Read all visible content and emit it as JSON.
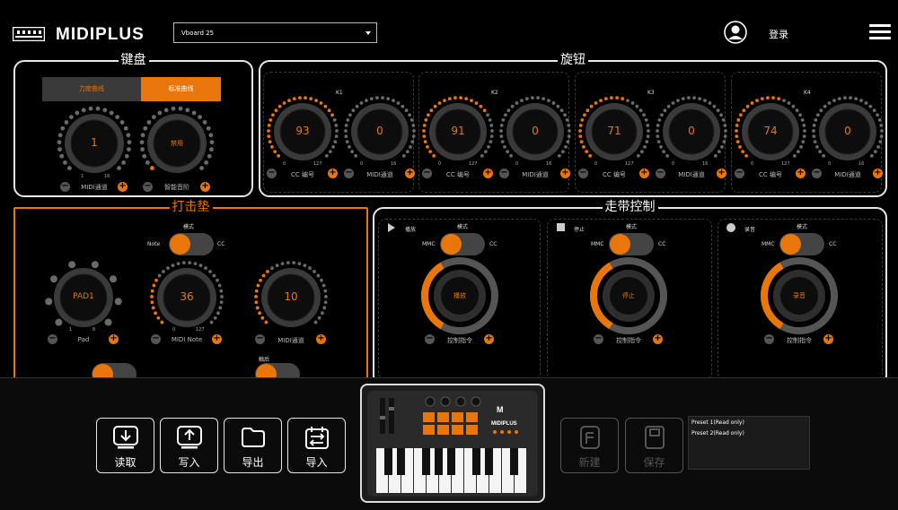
{
  "header": {
    "logo_text": "MIDIPLUS",
    "device_selected": "Vboard 25",
    "login_label": "登录"
  },
  "keyboard": {
    "title": "键盘",
    "tabs": [
      "力度曲线",
      "标准曲线"
    ],
    "active_tab": 1,
    "knobs": [
      {
        "value": "1",
        "label": "MIDI通道",
        "min": "1",
        "max": "16"
      },
      {
        "value": "禁用",
        "label": "智能音阶",
        "min": "",
        "max": ""
      }
    ]
  },
  "rotary": {
    "title": "旋钮",
    "groups": [
      {
        "name": "K1",
        "cc": {
          "value": "93",
          "label": "CC 编号",
          "min": "0",
          "max": "127"
        },
        "ch": {
          "value": "0",
          "label": "MIDI通道",
          "min": "0",
          "max": "16"
        }
      },
      {
        "name": "K2",
        "cc": {
          "value": "91",
          "label": "CC 编号",
          "min": "0",
          "max": "127"
        },
        "ch": {
          "value": "0",
          "label": "MIDI通道",
          "min": "0",
          "max": "16"
        }
      },
      {
        "name": "K3",
        "cc": {
          "value": "71",
          "label": "CC 编号",
          "min": "0",
          "max": "127"
        },
        "ch": {
          "value": "0",
          "label": "MIDI通道",
          "min": "0",
          "max": "16"
        }
      },
      {
        "name": "K4",
        "cc": {
          "value": "74",
          "label": "CC 编号",
          "min": "0",
          "max": "127"
        },
        "ch": {
          "value": "0",
          "label": "MIDI通道",
          "min": "0",
          "max": "16"
        }
      }
    ]
  },
  "pads": {
    "title": "打击垫",
    "mode_label": "模式",
    "toggle_left": "Note",
    "toggle_right": "CC",
    "knobs": [
      {
        "value": "PAD1",
        "label": "Pad",
        "min": "1",
        "max": "8"
      },
      {
        "value": "36",
        "label": "MIDI Note",
        "min": "0",
        "max": "127"
      },
      {
        "value": "10",
        "label": "MIDI通道",
        "min": "",
        "max": ""
      }
    ],
    "extra_label": "触后"
  },
  "transport": {
    "title": "走带控制",
    "items": [
      {
        "name": "播放",
        "icon": "play-icon",
        "mode_label": "模式",
        "left": "MMC",
        "right": "CC",
        "value": "播放",
        "label": "控制指令"
      },
      {
        "name": "停止",
        "icon": "stop-icon",
        "mode_label": "模式",
        "left": "MMC",
        "right": "CC",
        "value": "停止",
        "label": "控制指令"
      },
      {
        "name": "录音",
        "icon": "record-icon",
        "mode_label": "模式",
        "left": "MMC",
        "right": "CC",
        "value": "录音",
        "label": "控制指令"
      }
    ]
  },
  "bottom": {
    "buttons": [
      {
        "label": "读取",
        "icon": "download-icon",
        "enabled": true
      },
      {
        "label": "写入",
        "icon": "upload-icon",
        "enabled": true
      },
      {
        "label": "导出",
        "icon": "folder-icon",
        "enabled": true
      },
      {
        "label": "导入",
        "icon": "import-icon",
        "enabled": true
      },
      {
        "label": "新建",
        "icon": "new-file-icon",
        "enabled": false
      },
      {
        "label": "保存",
        "icon": "save-icon",
        "enabled": false
      }
    ],
    "presets": [
      "Preset 1(Read only)",
      "Preset 2(Read only)"
    ]
  },
  "colors": {
    "accent": "#e8760a",
    "knob_ring": "#555555",
    "background": "#000000"
  }
}
